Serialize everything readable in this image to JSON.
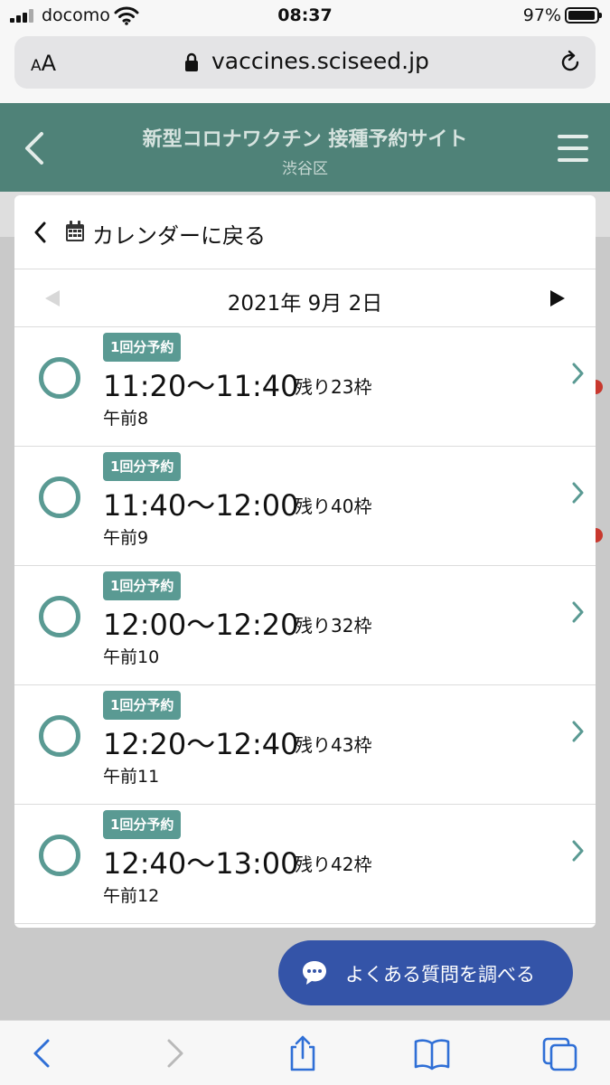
{
  "status_bar": {
    "carrier": "docomo",
    "time": "08:37",
    "battery": "97%",
    "battery_level": 0.97
  },
  "browser": {
    "text_size_label_small": "A",
    "text_size_label_large": "A",
    "url": "vaccines.sciseed.jp"
  },
  "site_header": {
    "title": "新型コロナワクチン 接種予約サイト",
    "subtitle": "渋谷区"
  },
  "card": {
    "back_label": "カレンダーに戻る",
    "date": "2021年 9月 2日"
  },
  "slots": [
    {
      "badge": "1回分予約",
      "time": "11:20〜11:40",
      "remaining": "残り23枠",
      "code": "午前8"
    },
    {
      "badge": "1回分予約",
      "time": "11:40〜12:00",
      "remaining": "残り40枠",
      "code": "午前9"
    },
    {
      "badge": "1回分予約",
      "time": "12:00〜12:20",
      "remaining": "残り32枠",
      "code": "午前10"
    },
    {
      "badge": "1回分予約",
      "time": "12:20〜12:40",
      "remaining": "残り43枠",
      "code": "午前11"
    },
    {
      "badge": "1回分予約",
      "time": "12:40〜13:00",
      "remaining": "残り42枠",
      "code": "午前12"
    }
  ],
  "faq_button": {
    "label": "よくある質問を調べる"
  },
  "colors": {
    "header_bg": "#4f8278",
    "accent_teal": "#5a9a93",
    "faq_blue": "#3454a8",
    "ios_blue": "#2f6fd6"
  },
  "icons": {
    "signal": "cellular-signal-icon",
    "wifi": "wifi-icon",
    "lock": "lock-icon",
    "reload": "reload-icon",
    "back": "chevron-left-icon",
    "menu": "hamburger-menu-icon",
    "calendar": "calendar-icon",
    "slot_status": "circle-available-icon",
    "slot_arrow": "chevron-right-icon",
    "faq": "chat-bubble-icon",
    "toolbar": [
      "back-icon",
      "forward-icon",
      "share-icon",
      "bookmarks-icon",
      "tabs-icon"
    ]
  }
}
